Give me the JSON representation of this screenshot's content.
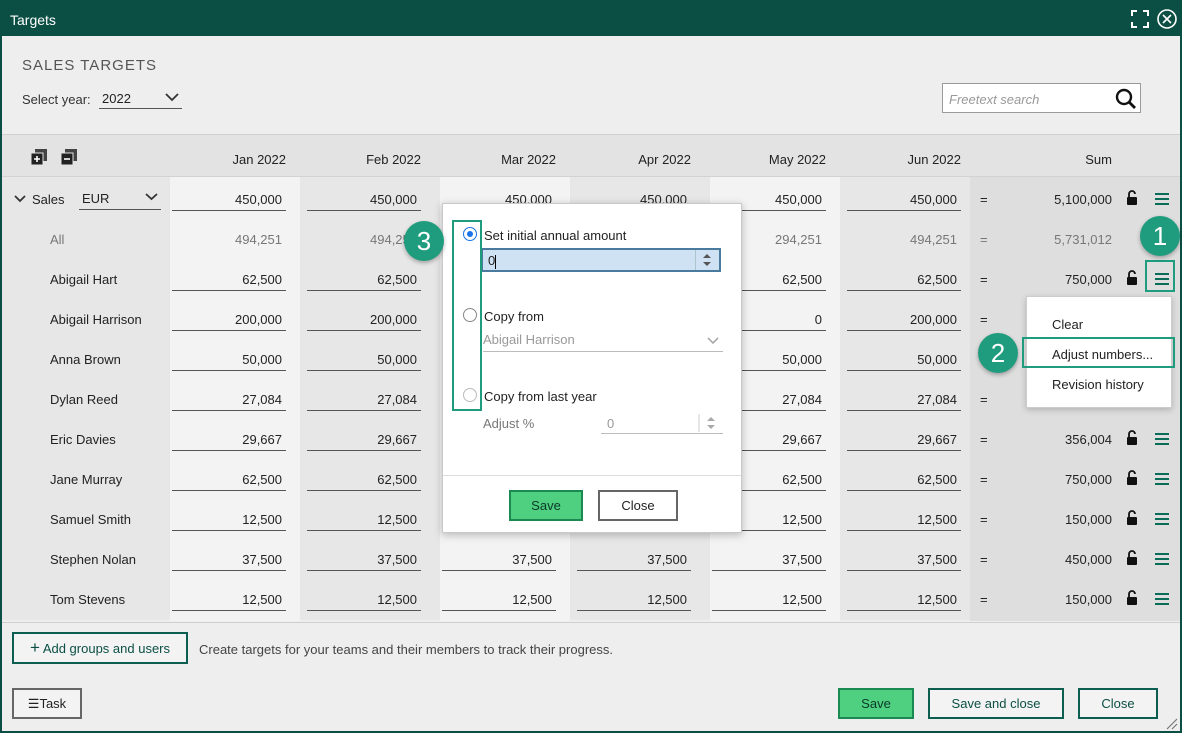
{
  "window": {
    "title": "Targets"
  },
  "header": {
    "title": "SALES TARGETS",
    "year_label": "Select year:",
    "year_value": "2022",
    "search_placeholder": "Freetext search"
  },
  "columns": [
    "Jan 2022",
    "Feb 2022",
    "Mar 2022",
    "Apr 2022",
    "May 2022",
    "Jun 2022"
  ],
  "sum_label": "Sum",
  "group": {
    "name": "Sales",
    "currency": "EUR",
    "values": [
      "450,000",
      "450,000",
      "450,000",
      "450,000",
      "450,000",
      "450,000"
    ],
    "eq": "=",
    "sum": "5,100,000"
  },
  "all_row": {
    "name": "All",
    "values": [
      "494,251",
      "494,251",
      "",
      "",
      "294,251",
      "494,251"
    ],
    "eq": "=",
    "sum": "5,731,012"
  },
  "rows": [
    {
      "name": "Abigail Hart",
      "values": [
        "62,500",
        "62,500",
        "",
        "",
        "62,500",
        "62,500"
      ],
      "sum": "750,000"
    },
    {
      "name": "Abigail Harrison",
      "values": [
        "200,000",
        "200,000",
        "",
        "",
        "0",
        "200,000"
      ],
      "sum": ""
    },
    {
      "name": "Anna Brown",
      "values": [
        "50,000",
        "50,000",
        "",
        "",
        "50,000",
        "50,000"
      ],
      "sum": ""
    },
    {
      "name": "Dylan Reed",
      "values": [
        "27,084",
        "27,084",
        "",
        "",
        "27,084",
        "27,084"
      ],
      "sum": ""
    },
    {
      "name": "Eric Davies",
      "values": [
        "29,667",
        "29,667",
        "",
        "",
        "29,667",
        "29,667"
      ],
      "sum": "356,004"
    },
    {
      "name": "Jane Murray",
      "values": [
        "62,500",
        "62,500",
        "",
        "",
        "62,500",
        "62,500"
      ],
      "sum": "750,000"
    },
    {
      "name": "Samuel Smith",
      "values": [
        "12,500",
        "12,500",
        "",
        "",
        "12,500",
        "12,500"
      ],
      "sum": "150,000"
    },
    {
      "name": "Stephen Nolan",
      "values": [
        "37,500",
        "37,500",
        "37,500",
        "37,500",
        "37,500",
        "37,500"
      ],
      "sum": "450,000"
    },
    {
      "name": "Tom Stevens",
      "values": [
        "12,500",
        "12,500",
        "12,500",
        "12,500",
        "12,500",
        "12,500"
      ],
      "sum": "150,000"
    }
  ],
  "eq": "=",
  "footer": {
    "add_label": "Add groups and users",
    "hint": "Create targets for your teams and their members to track their progress.",
    "task_label": "Task",
    "save": "Save",
    "save_close": "Save and close",
    "close": "Close"
  },
  "dialog": {
    "opt1": "Set initial annual amount",
    "amount": "0",
    "opt2": "Copy from",
    "copy_value": "Abigail Harrison",
    "opt3": "Copy from last year",
    "adjust_label": "Adjust %",
    "adjust_value": "0",
    "save": "Save",
    "close": "Close"
  },
  "context_menu": {
    "items": [
      "Clear",
      "Adjust numbers...",
      "Revision history"
    ]
  },
  "callouts": [
    "1",
    "2",
    "3"
  ]
}
